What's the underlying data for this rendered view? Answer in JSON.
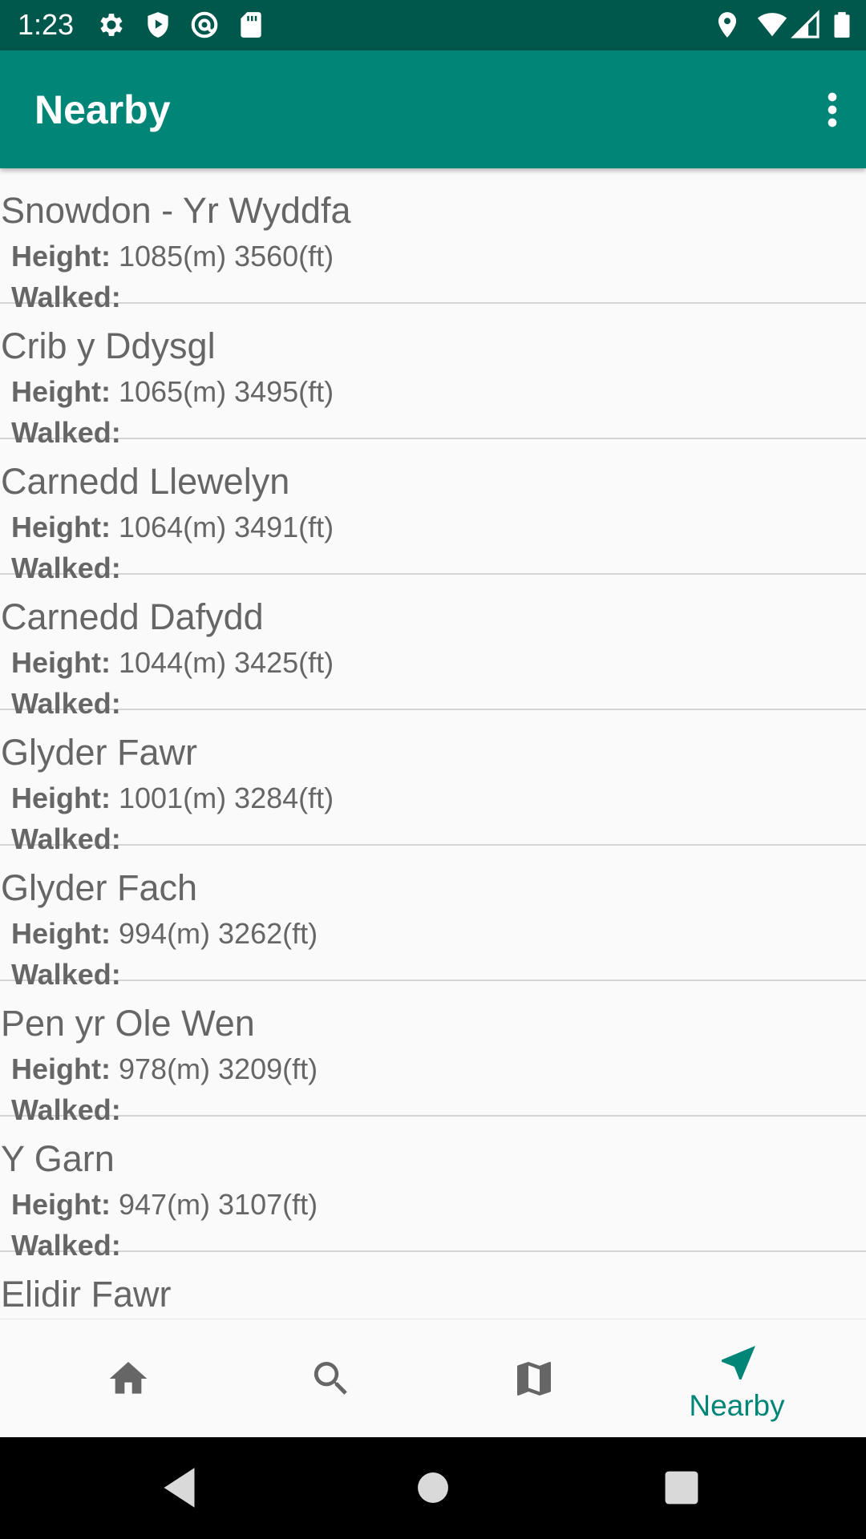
{
  "status_bar": {
    "time": "1:23",
    "icons_left": [
      "gear-icon",
      "shield-play-icon",
      "at-sign-icon",
      "sd-card-icon"
    ],
    "icons_right": [
      "location-icon",
      "wifi-icon",
      "signal-icon",
      "battery-icon"
    ]
  },
  "app_bar": {
    "title": "Nearby",
    "overflow_icon": "more-vert-icon",
    "background": "#008577"
  },
  "list": {
    "height_label": "Height:",
    "walked_label": "Walked:",
    "items": [
      {
        "name": "Snowdon - Yr Wyddfa",
        "height": "1085(m) 3560(ft)",
        "walked": ""
      },
      {
        "name": "Crib y Ddysgl",
        "height": "1065(m) 3495(ft)",
        "walked": ""
      },
      {
        "name": "Carnedd Llewelyn",
        "height": "1064(m) 3491(ft)",
        "walked": ""
      },
      {
        "name": "Carnedd Dafydd",
        "height": "1044(m) 3425(ft)",
        "walked": ""
      },
      {
        "name": "Glyder Fawr",
        "height": "1001(m) 3284(ft)",
        "walked": ""
      },
      {
        "name": "Glyder Fach",
        "height": "994(m) 3262(ft)",
        "walked": ""
      },
      {
        "name": "Pen yr Ole Wen",
        "height": "978(m) 3209(ft)",
        "walked": ""
      },
      {
        "name": "Y Garn",
        "height": "947(m) 3107(ft)",
        "walked": ""
      },
      {
        "name": "Elidir Fawr",
        "height": "",
        "walked": ""
      }
    ]
  },
  "bottom_nav": {
    "items": [
      {
        "icon": "home-icon",
        "label": "",
        "selected": false
      },
      {
        "icon": "search-icon",
        "label": "",
        "selected": false
      },
      {
        "icon": "map-icon",
        "label": "",
        "selected": false
      },
      {
        "icon": "navigation-icon",
        "label": "Nearby",
        "selected": true
      }
    ],
    "active_color": "#008577",
    "inactive_color": "#666666"
  },
  "system_nav": {
    "buttons": [
      "back-icon",
      "home-circle-icon",
      "recents-icon"
    ]
  }
}
